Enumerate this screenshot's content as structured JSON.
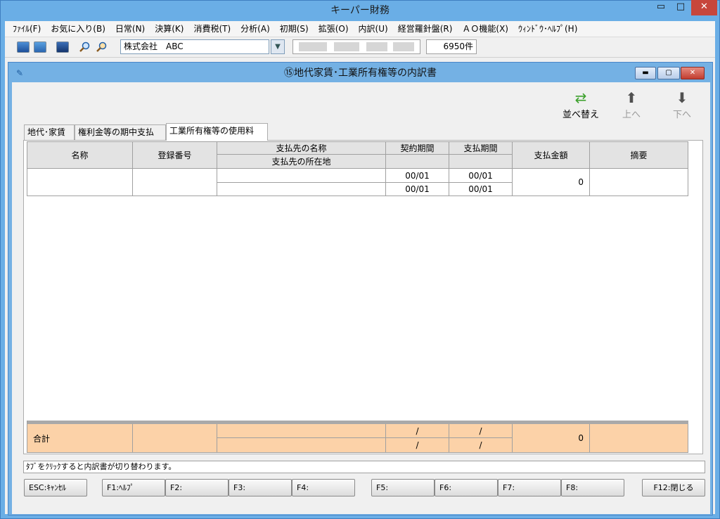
{
  "window": {
    "title": "キーパー財務",
    "min_glyph": "▭",
    "max_glyph": "□",
    "close_glyph": "✕"
  },
  "menu": [
    "ﾌｧｲﾙ(F)",
    "お気に入り(B)",
    "日常(N)",
    "決算(K)",
    "消費税(T)",
    "分析(A)",
    "初期(S)",
    "拡張(O)",
    "内訳(U)",
    "経営羅針盤(R)",
    "ＡＯ機能(X)",
    "ｳｨﾝﾄﾞｳ･ﾍﾙﾌﾟ(H)"
  ],
  "toolbar": {
    "company": "株式会社　ABC",
    "count": "6950件"
  },
  "inner": {
    "title": "⑮地代家賃･工業所有権等の内訳書"
  },
  "actions": {
    "sort": "並べ替え",
    "up": "上へ",
    "down": "下へ"
  },
  "tabs": [
    "地代･家賃",
    "権利金等の期中支払",
    "工業所有権等の使用料"
  ],
  "table": {
    "headers": {
      "name": "名称",
      "reg_no": "登録番号",
      "payee_name": "支払先の名称",
      "payee_addr": "支払先の所在地",
      "contract": "契約期間",
      "pay_period": "支払期間",
      "amount": "支払金額",
      "memo": "摘要"
    },
    "row": {
      "contract_from": "00/01",
      "contract_to": "00/01",
      "pay_from": "00/01",
      "pay_to": "00/01",
      "amount": "0"
    },
    "total": {
      "label": "合計",
      "contract_from": "/",
      "contract_to": "/",
      "pay_from": "/",
      "pay_to": "/",
      "amount": "0"
    }
  },
  "status": "ﾀﾌﾞをｸﾘｯｸすると内訳書が切り替わります。",
  "fkeys": [
    "ESC:ｷｬﾝｾﾙ",
    "F1:ﾍﾙﾌﾟ",
    "F2:",
    "F3:",
    "F4:",
    "F5:",
    "F6:",
    "F7:",
    "F8:",
    "F12:閉じる"
  ]
}
